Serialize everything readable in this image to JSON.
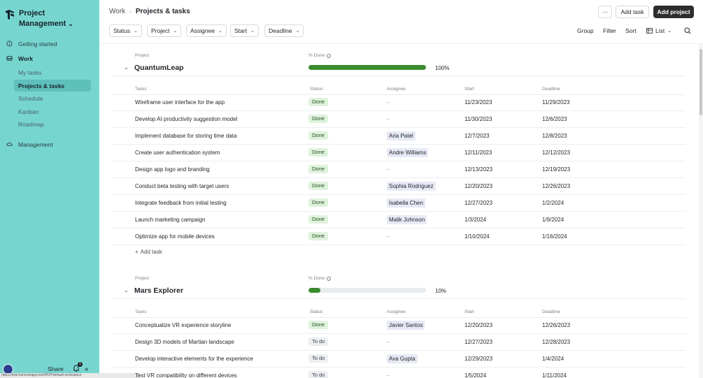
{
  "sidebar": {
    "title_line1": "Project",
    "title_line2": "Management",
    "nav": [
      {
        "label": "Getting started",
        "icon": "info-icon"
      },
      {
        "label": "Work",
        "icon": "inbox-icon"
      },
      {
        "label": "Management",
        "icon": "cloud-icon"
      }
    ],
    "subnav": [
      "My tasks",
      "Projects & tasks",
      "Schedule",
      "Kanban",
      "Roadmap"
    ],
    "share_label": "Share",
    "notification_count": "1",
    "status_url": "https://trial.harvestrapp.tool/MVP/default-workspace"
  },
  "header": {
    "breadcrumb_parent": "Work",
    "breadcrumb_current": "Projects & tasks",
    "more_label": "···",
    "add_task_label": "Add task",
    "add_project_label": "Add project"
  },
  "filters": [
    "Status",
    "Project",
    "Assignee",
    "Start",
    "Deadline"
  ],
  "tools": {
    "group": "Group",
    "filter": "Filter",
    "sort": "Sort",
    "view": "List"
  },
  "columns": {
    "project": "Project",
    "pct_done": "% Done",
    "tasks": "Tasks",
    "status": "Status",
    "assignee": "Assignee",
    "start": "Start",
    "deadline": "Deadline"
  },
  "add_task_inline": "Add task",
  "projects": [
    {
      "name": "QuantumLeap",
      "pct_label": "100%",
      "pct": 1.0,
      "tasks": [
        {
          "name": "Wireframe user interface for the app",
          "status": "Done",
          "assignee": "–",
          "start": "11/23/2023",
          "deadline": "11/29/2023"
        },
        {
          "name": "Develop AI productivity suggestion model",
          "status": "Done",
          "assignee": "–",
          "start": "11/30/2023",
          "deadline": "12/6/2023"
        },
        {
          "name": "Implement database for storing time data",
          "status": "Done",
          "assignee": "Aria Patel",
          "start": "12/7/2023",
          "deadline": "12/8/2023"
        },
        {
          "name": "Create user authentication system",
          "status": "Done",
          "assignee": "Andre Williams",
          "start": "12/11/2023",
          "deadline": "12/12/2023"
        },
        {
          "name": "Design app logo and branding",
          "status": "Done",
          "assignee": "–",
          "start": "12/13/2023",
          "deadline": "12/19/2023"
        },
        {
          "name": "Conduct beta testing with target users",
          "status": "Done",
          "assignee": "Sophia Rodriguez",
          "start": "12/20/2023",
          "deadline": "12/26/2023"
        },
        {
          "name": "Integrate feedback from initial testing",
          "status": "Done",
          "assignee": "Isabella Chen",
          "start": "12/27/2023",
          "deadline": "1/2/2024"
        },
        {
          "name": "Launch marketing campaign",
          "status": "Done",
          "assignee": "Malik Johnson",
          "start": "1/3/2024",
          "deadline": "1/9/2024"
        },
        {
          "name": "Optimize app for mobile devices",
          "status": "Done",
          "assignee": "–",
          "start": "1/10/2024",
          "deadline": "1/16/2024"
        }
      ]
    },
    {
      "name": "Mars Explorer",
      "pct_label": "10%",
      "pct": 0.1,
      "tasks": [
        {
          "name": "Conceptualize VR experience storyline",
          "status": "Done",
          "assignee": "Javier Santos",
          "start": "12/20/2023",
          "deadline": "12/26/2023"
        },
        {
          "name": "Design 3D models of Martian landscape",
          "status": "To do",
          "assignee": "–",
          "start": "12/27/2023",
          "deadline": "12/28/2023"
        },
        {
          "name": "Develop interactive elements for the experience",
          "status": "To do",
          "assignee": "Ava Gupta",
          "start": "12/29/2023",
          "deadline": "1/4/2024"
        },
        {
          "name": "Test VR compatibility on different devices",
          "status": "To do",
          "assignee": "–",
          "start": "1/5/2024",
          "deadline": "1/11/2024"
        }
      ]
    }
  ],
  "colors": {
    "sidebar_bg": "#77d5d0",
    "progress": "#3b8a2f",
    "done_pill": "#dff2dc",
    "todo_pill": "#eceef1",
    "primary_button": "#2d2d2d"
  }
}
